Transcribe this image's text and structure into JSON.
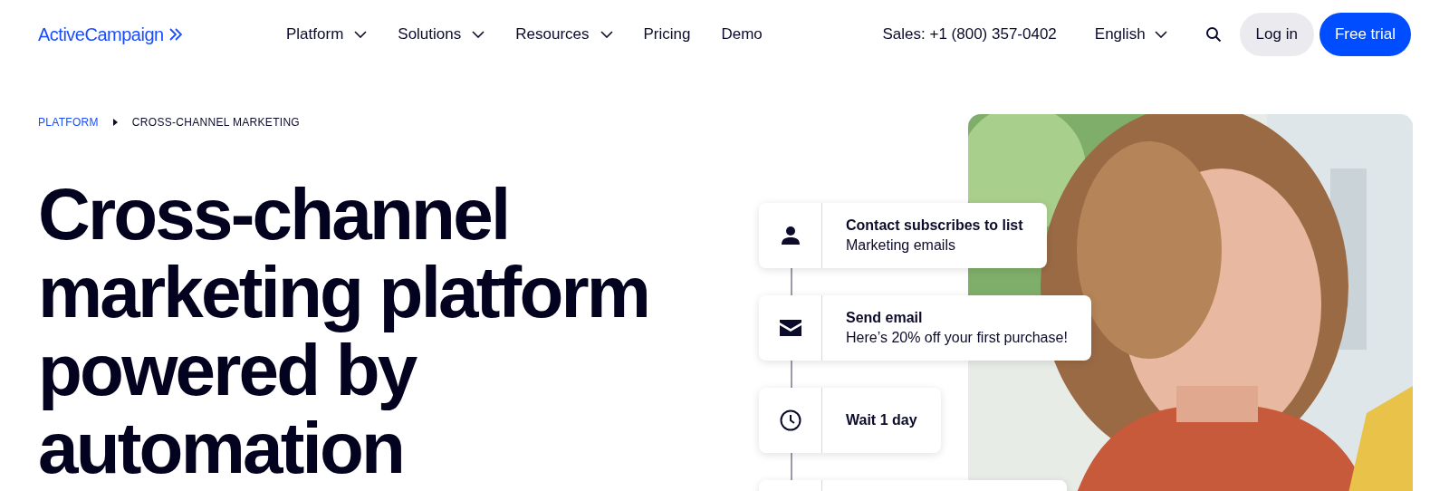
{
  "logo": {
    "text": "ActiveCampaign"
  },
  "nav": [
    {
      "label": "Platform",
      "dropdown": true
    },
    {
      "label": "Solutions",
      "dropdown": true
    },
    {
      "label": "Resources",
      "dropdown": true
    },
    {
      "label": "Pricing",
      "dropdown": false
    },
    {
      "label": "Demo",
      "dropdown": false
    }
  ],
  "sales": "Sales: +1 (800) 357-0402",
  "language": "English",
  "buttons": [
    {
      "label": "Log in",
      "kind": "secondary"
    },
    {
      "label": "Free trial",
      "kind": "primary"
    }
  ],
  "breadcrumb": [
    {
      "label": "PLATFORM",
      "kind": "link"
    },
    {
      "label": "CROSS-CHANNEL MARKETING",
      "kind": "current"
    }
  ],
  "headline": "Cross-channel marketing platform powered by automation",
  "workflow": [
    {
      "kind": "contact",
      "title": "Contact subscribes to list",
      "subtitle": "Marketing emails"
    },
    {
      "kind": "email",
      "title": "Send email",
      "subtitle": "Here’s 20% off your first purchase!"
    },
    {
      "kind": "wait",
      "title": "Wait 1 day"
    },
    {
      "kind": "blank"
    }
  ]
}
